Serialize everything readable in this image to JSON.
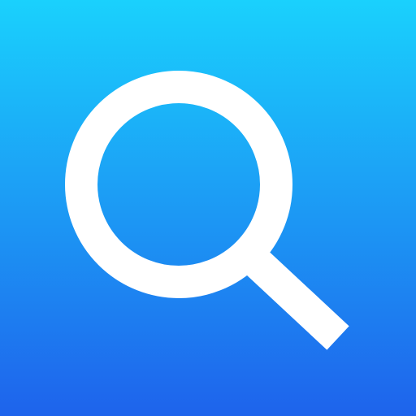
{
  "icon": {
    "name": "search-icon",
    "background_top": "#1ad1fd",
    "background_bottom": "#1e63ec",
    "glyph_color": "#ffffff"
  }
}
